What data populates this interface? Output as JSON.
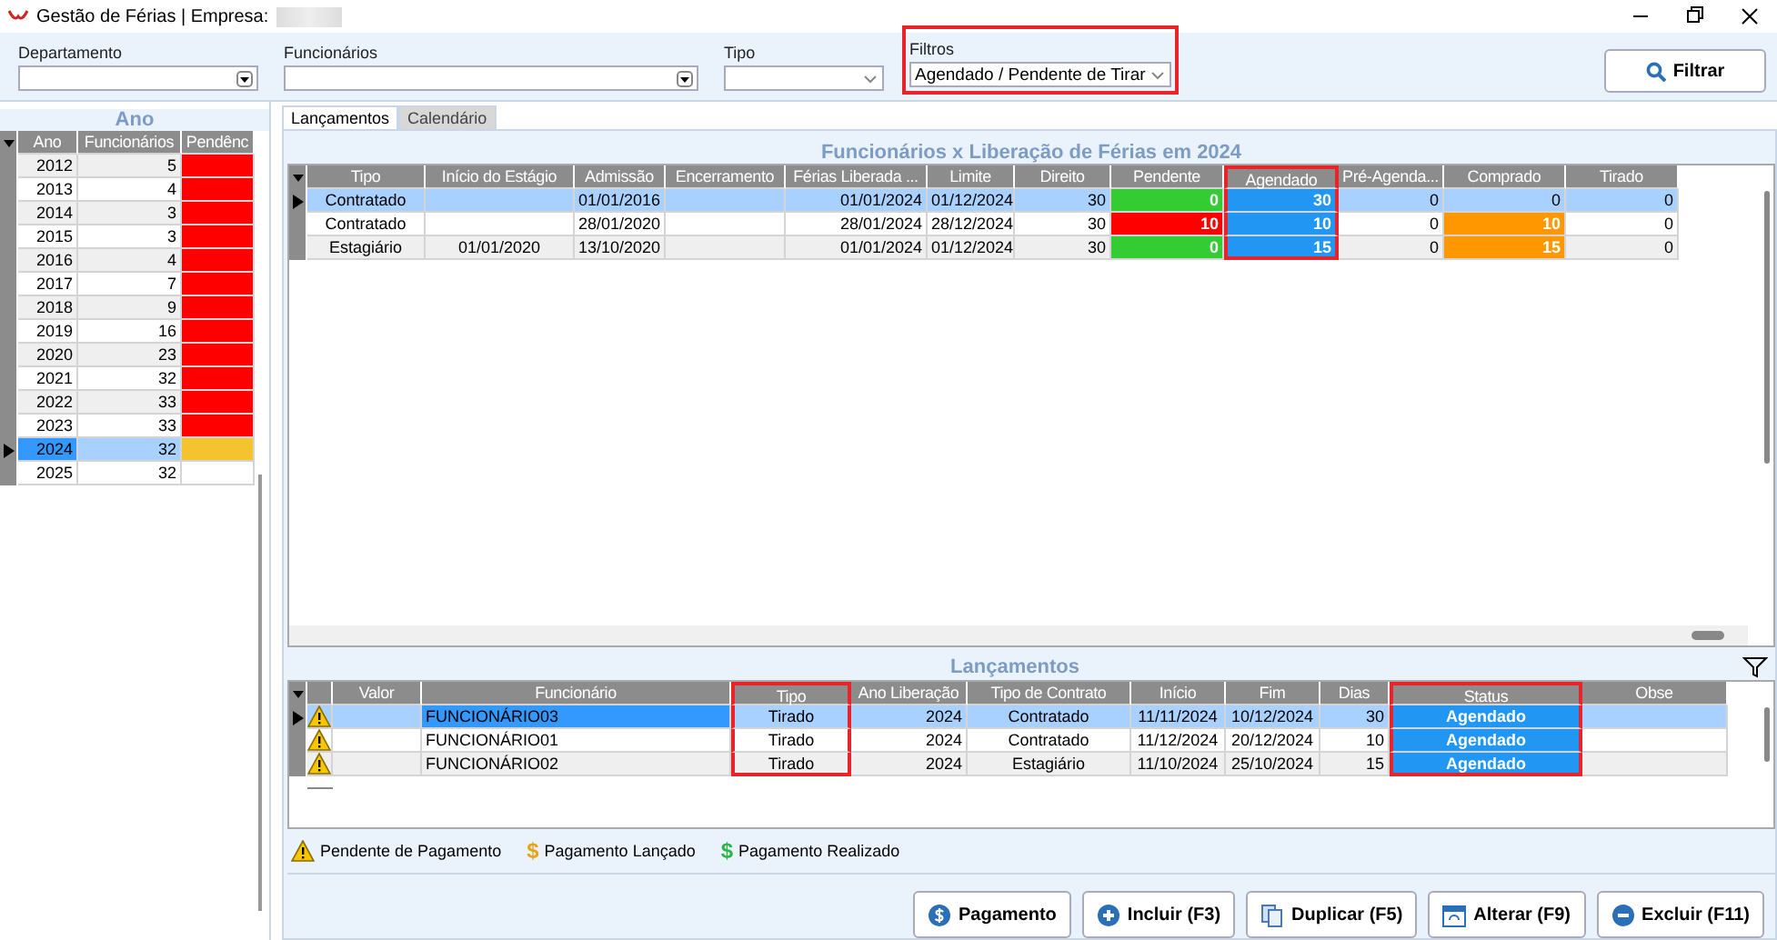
{
  "window": {
    "title": "Gestão de Férias | Empresa:"
  },
  "filters": [
    {
      "label": "Departamento",
      "kind": "combo",
      "highlighted": false
    },
    {
      "label": "Funcionários",
      "kind": "combo",
      "highlighted": false
    },
    {
      "label": "Tipo",
      "kind": "plain",
      "highlighted": false
    },
    {
      "label": "Filtros",
      "kind": "plain",
      "value": "Agendado / Pendente de Tirar",
      "highlighted": true
    }
  ],
  "filter_button": {
    "label": "Filtrar"
  },
  "years_panel": {
    "title": "Ano",
    "columns": [
      "Ano",
      "Funcionários",
      "Pendênc"
    ],
    "rows": [
      {
        "year": "2012",
        "employees": "5",
        "color": "#ff0000",
        "selected": false
      },
      {
        "year": "2013",
        "employees": "4",
        "color": "#ff0000",
        "selected": false
      },
      {
        "year": "2014",
        "employees": "3",
        "color": "#ff0000",
        "selected": false
      },
      {
        "year": "2015",
        "employees": "3",
        "color": "#ff0000",
        "selected": false
      },
      {
        "year": "2016",
        "employees": "4",
        "color": "#ff0000",
        "selected": false
      },
      {
        "year": "2017",
        "employees": "7",
        "color": "#ff0000",
        "selected": false
      },
      {
        "year": "2018",
        "employees": "9",
        "color": "#ff0000",
        "selected": false
      },
      {
        "year": "2019",
        "employees": "16",
        "color": "#ff0000",
        "selected": false
      },
      {
        "year": "2020",
        "employees": "23",
        "color": "#ff0000",
        "selected": false
      },
      {
        "year": "2021",
        "employees": "32",
        "color": "#ff0000",
        "selected": false
      },
      {
        "year": "2022",
        "employees": "33",
        "color": "#ff0000",
        "selected": false
      },
      {
        "year": "2023",
        "employees": "33",
        "color": "#ff0000",
        "selected": false
      },
      {
        "year": "2024",
        "employees": "32",
        "color": "#f4c430",
        "selected": true
      },
      {
        "year": "2025",
        "employees": "32",
        "selected": false
      }
    ]
  },
  "tabs": [
    {
      "label": "Lançamentos",
      "selected": true
    },
    {
      "label": "Calendário",
      "selected": false
    }
  ],
  "releases_grid": {
    "title": "Funcionários x Liberação de Férias em 2024",
    "columns": [
      {
        "label": "Tipo",
        "highlighted": false
      },
      {
        "label": "Início do Estágio",
        "highlighted": false
      },
      {
        "label": "Admissão",
        "highlighted": false
      },
      {
        "label": "Encerramento",
        "highlighted": false
      },
      {
        "label": "Férias Liberada ...",
        "highlighted": false
      },
      {
        "label": "Limite",
        "highlighted": false
      },
      {
        "label": "Direito",
        "highlighted": false
      },
      {
        "label": "Pendente",
        "highlighted": false
      },
      {
        "label": "Agendado",
        "highlighted": true
      },
      {
        "label": "Pré-Agenda...",
        "highlighted": false
      },
      {
        "label": "Comprado",
        "highlighted": false
      },
      {
        "label": "Tirado",
        "highlighted": false
      }
    ],
    "rows": [
      {
        "selected": true,
        "cells": [
          "Contratado",
          null,
          "01/01/2016",
          null,
          "01/01/2024",
          "01/12/2024",
          "30",
          {
            "text": "0",
            "color": "#33cc33"
          },
          {
            "text": "30",
            "color": "#2196f3"
          },
          "0",
          "0",
          "0"
        ]
      },
      {
        "selected": false,
        "cells": [
          "Contratado",
          null,
          "28/01/2020",
          null,
          "28/01/2024",
          "28/12/2024",
          "30",
          {
            "text": "10",
            "color": "#ff0000"
          },
          {
            "text": "10",
            "color": "#2196f3"
          },
          "0",
          {
            "text": "10",
            "color": "#ff9800"
          },
          "0"
        ]
      },
      {
        "selected": false,
        "cells": [
          "Estagiário",
          "01/01/2020",
          "13/10/2020",
          null,
          "01/01/2024",
          "01/12/2024",
          "30",
          {
            "text": "0",
            "color": "#33cc33"
          },
          {
            "text": "15",
            "color": "#2196f3"
          },
          "0",
          {
            "text": "15",
            "color": "#ff9800"
          },
          "0"
        ]
      }
    ]
  },
  "entries_grid": {
    "title": "Lançamentos",
    "columns": [
      {
        "label": "Valor",
        "highlighted": false
      },
      {
        "label": "Funcionário",
        "highlighted": false
      },
      {
        "label": "Tipo",
        "highlighted": true
      },
      {
        "label": "Ano Liberação",
        "highlighted": false
      },
      {
        "label": "Tipo de Contrato",
        "highlighted": false
      },
      {
        "label": "Início",
        "highlighted": false
      },
      {
        "label": "Fim",
        "highlighted": false
      },
      {
        "label": "Dias",
        "highlighted": false
      },
      {
        "label": "Status",
        "highlighted": true
      },
      {
        "label": "Obse",
        "highlighted": false
      }
    ],
    "rows": [
      {
        "selected": true,
        "kind": "warning",
        "cells": [
          null,
          {
            "text": "FUNCIONÁRIO03",
            "focused": true
          },
          "Tirado",
          "2024",
          "Contratado",
          "11/11/2024",
          "10/12/2024",
          "30",
          {
            "text": "Agendado",
            "color": "#2196f3"
          },
          null
        ]
      },
      {
        "selected": false,
        "kind": "warning",
        "cells": [
          null,
          {
            "text": "FUNCIONÁRIO01",
            "focused": false
          },
          "Tirado",
          "2024",
          "Contratado",
          "11/12/2024",
          "20/12/2024",
          "10",
          {
            "text": "Agendado",
            "color": "#2196f3"
          },
          null
        ]
      },
      {
        "selected": false,
        "kind": "warning",
        "cells": [
          null,
          {
            "text": "FUNCIONÁRIO02",
            "focused": false
          },
          "Tirado",
          "2024",
          "Estagiário",
          "11/10/2024",
          "25/10/2024",
          "15",
          {
            "text": "Agendado",
            "color": "#2196f3"
          },
          null
        ]
      }
    ]
  },
  "legend": [
    {
      "kind": "warning",
      "label": "Pendente de Pagamento"
    },
    {
      "kind": "launched",
      "icon": "$",
      "label": "Pagamento Lançado"
    },
    {
      "kind": "done",
      "icon": "$",
      "label": "Pagamento Realizado"
    }
  ],
  "buttons": [
    {
      "kind": "payment",
      "label": "Pagamento"
    },
    {
      "kind": "add",
      "label": "Incluir (F3)"
    },
    {
      "kind": "copy",
      "label": "Duplicar (F5)"
    },
    {
      "kind": "edit",
      "label": "Alterar (F9)"
    },
    {
      "kind": "remove",
      "label": "Excluir (F11)"
    }
  ]
}
